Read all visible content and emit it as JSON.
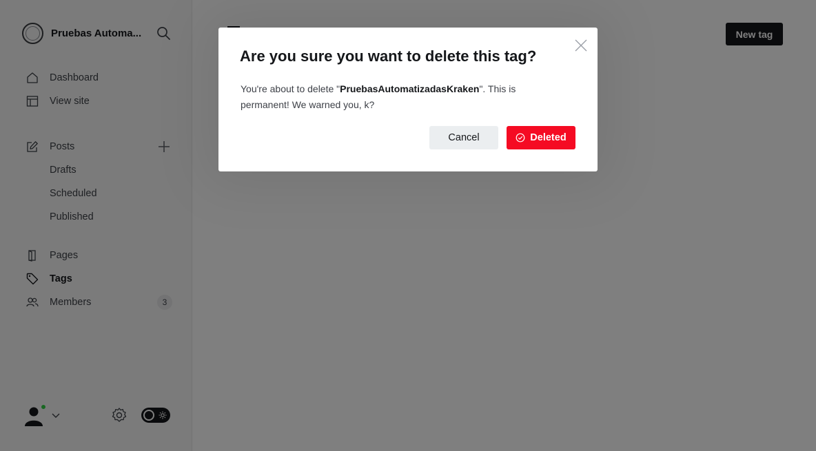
{
  "sidebar": {
    "site_title": "Pruebas Automa...",
    "nav_primary": [
      {
        "label": "Dashboard",
        "icon": "home-icon"
      },
      {
        "label": "View site",
        "icon": "layout-icon"
      }
    ],
    "posts": {
      "label": "Posts",
      "icon": "edit-icon",
      "sub_items": [
        "Drafts",
        "Scheduled",
        "Published"
      ]
    },
    "nav_secondary": [
      {
        "label": "Pages",
        "icon": "page-icon"
      },
      {
        "label": "Tags",
        "icon": "tag-icon",
        "active": true
      },
      {
        "label": "Members",
        "icon": "members-icon",
        "badge": "3"
      }
    ]
  },
  "main": {
    "new_tag_label": "New tag"
  },
  "modal": {
    "title": "Are you sure you want to delete this tag?",
    "body_prefix": "You're about to delete \"",
    "tag_name": "PruebasAutomatizadasKraken",
    "body_suffix": "\". This is permanent! We warned you, k?",
    "cancel_label": "Cancel",
    "delete_label": "Deleted"
  },
  "colors": {
    "accent_dark": "#15171a",
    "danger": "#f50b23",
    "status_online": "#30cf43"
  }
}
